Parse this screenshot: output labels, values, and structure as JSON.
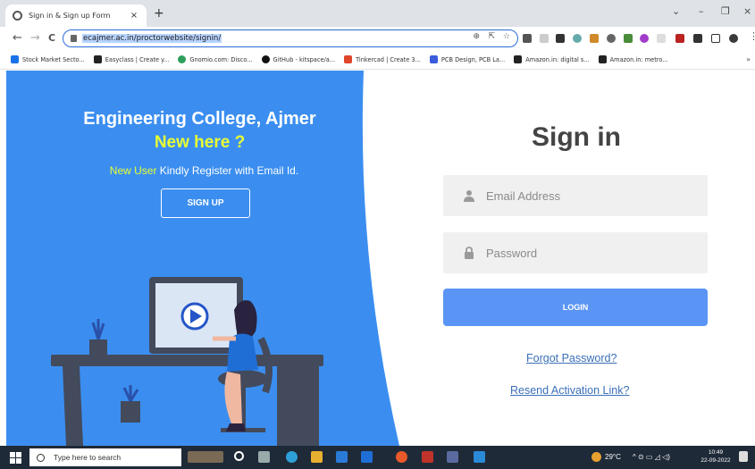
{
  "browser": {
    "tab_title": "Sign in & Sign up Form",
    "tab_close": "×",
    "new_tab": "+",
    "url": "ecajmer.ac.in/proctorwebsite/signin/",
    "nav": {
      "back": "←",
      "forward": "→",
      "reload": "C"
    },
    "window_controls": {
      "dropdown": "⌄",
      "minimize": "–",
      "restore": "❐",
      "close": "×"
    },
    "bookmarks": [
      {
        "label": "Stock Market Secto...",
        "color": "#1a73e8"
      },
      {
        "label": "Easyclass | Create y...",
        "color": "#222222"
      },
      {
        "label": "Gnomio.com: Disco...",
        "color": "#2e9f5a"
      },
      {
        "label": "GitHub - kitspace/a...",
        "color": "#111111"
      },
      {
        "label": "Tinkercad | Create 3...",
        "color": "#e0462a"
      },
      {
        "label": "PCB Design, PCB La...",
        "color": "#3b5bdb"
      },
      {
        "label": "Amazon.in: digital s...",
        "color": "#222222"
      },
      {
        "label": "Amazon.in: metro...",
        "color": "#222222"
      }
    ],
    "bookmarks_more": "»"
  },
  "hero": {
    "title": "Engineering College, Ajmer",
    "subtitle": "New here ?",
    "line_highlight": "New User",
    "line_rest": " Kindly Register with Email Id.",
    "signup_label": "SIGN UP"
  },
  "signin": {
    "title": "Sign in",
    "email_placeholder": "Email Address",
    "password_placeholder": "Password",
    "login_label": "LOGIN",
    "forgot_label": "Forgot Password?",
    "resend_label": "Resend Activation Link?"
  },
  "taskbar": {
    "search_placeholder": "Type here to search",
    "weather": "29°C",
    "tray_symbols": "^ ⊙ ▭ ◿ ◁)",
    "time": "10:49",
    "date": "22-09-2022"
  },
  "colors": {
    "brand_blue": "#3b8ef0",
    "highlight_yellow": "#e8ff33",
    "login_blue": "#5a95f5",
    "link_blue": "#3a6fb8"
  }
}
